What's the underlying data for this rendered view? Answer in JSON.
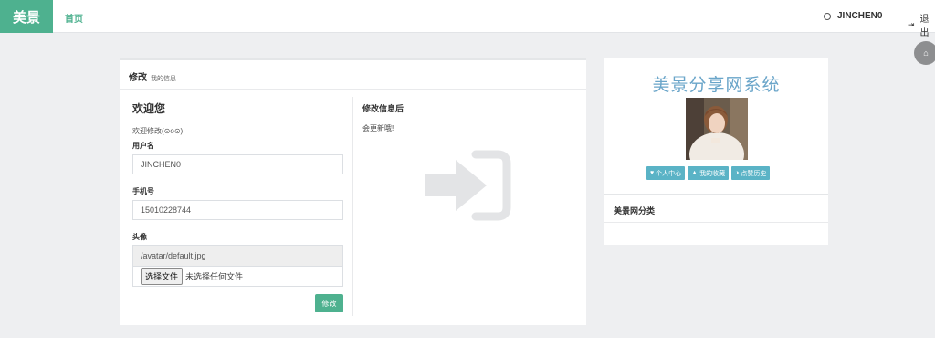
{
  "nav": {
    "brand": "美景",
    "home": "首页",
    "username": "JINCHEN0",
    "logout": "退出"
  },
  "edit": {
    "title": "修改",
    "subtitle": "我的信息",
    "welcome_title": "欢迎您",
    "welcome_sub": "欢迎修改(⊙o⊙)",
    "username_label": "用户名",
    "username_value": "JINCHEN0",
    "phone_label": "手机号",
    "phone_value": "15010228744",
    "avatar_label": "头像",
    "avatar_value": "/avatar/default.jpg",
    "file_button": "选择文件",
    "file_status": "未选择任何文件",
    "save_button": "修改",
    "info_title": "修改信息后",
    "info_sub": "会更新哦!"
  },
  "profile": {
    "system_title": "美景分享网系统",
    "tags": [
      {
        "icon": "heart-icon",
        "label": "个人中心"
      },
      {
        "icon": "thumbs-up-icon",
        "label": "我的收藏"
      },
      {
        "icon": "half-circle-icon",
        "label": "点赞历史"
      }
    ]
  },
  "category": {
    "title": "美景网分类"
  },
  "colors": {
    "accent": "#4eb18f",
    "tag": "#5ab3c6",
    "title_blue": "#6aa5c9"
  }
}
